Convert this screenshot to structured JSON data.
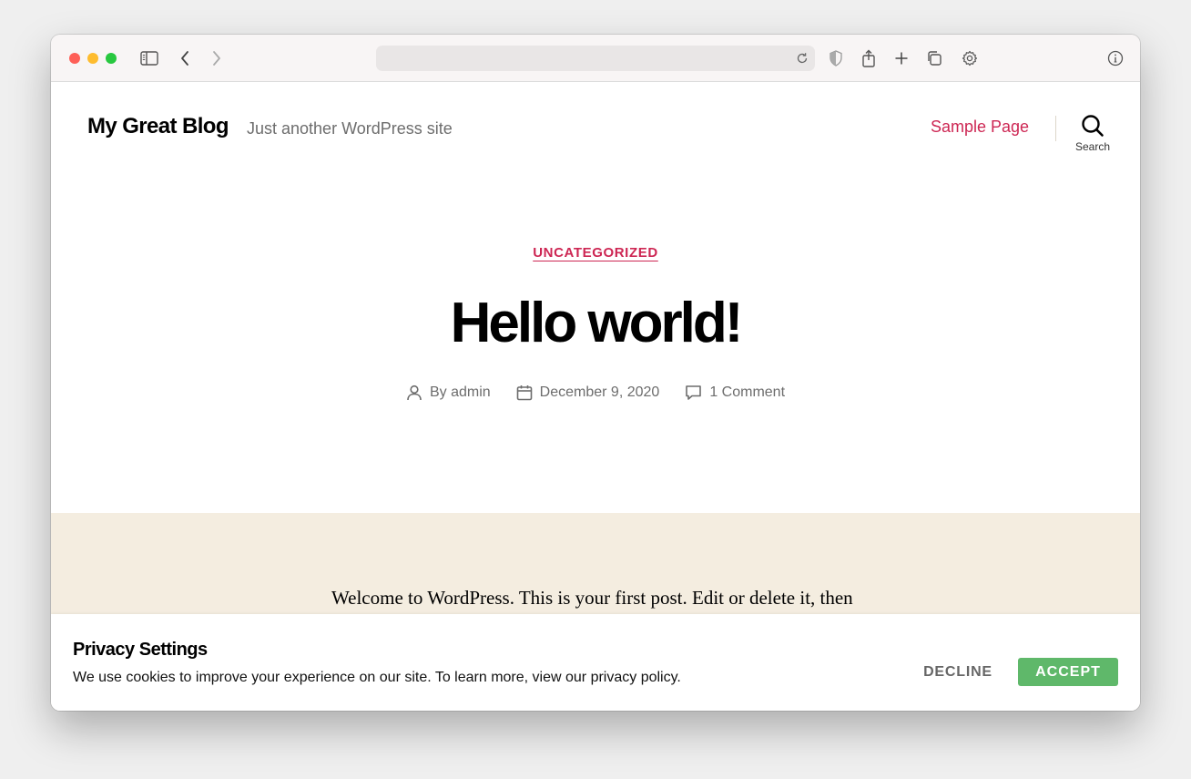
{
  "browser": {
    "icons": [
      "sidebar-icon",
      "back-icon",
      "forward-icon",
      "reload-icon",
      "privacy-shield-icon",
      "share-icon",
      "new-tab-icon",
      "tabs-overview-icon",
      "settings-gear-icon",
      "info-icon"
    ],
    "url": ""
  },
  "site": {
    "title": "My Great Blog",
    "description": "Just another WordPress site",
    "nav": {
      "sample_page": "Sample Page"
    },
    "search_label": "Search",
    "accent_color": "#cd2653"
  },
  "post": {
    "category": "UNCATEGORIZED",
    "title": "Hello world!",
    "author": "By admin",
    "date": "December 9, 2020",
    "comments": "1 Comment",
    "body": "Welcome to WordPress. This is your first post. Edit or delete it, then start writing!"
  },
  "cookie_banner": {
    "title": "Privacy Settings",
    "text": "We use cookies to improve your experience on our site. To learn more, view our privacy policy.",
    "decline_label": "DECLINE",
    "accept_label": "ACCEPT",
    "accept_color": "#5fb86a"
  }
}
